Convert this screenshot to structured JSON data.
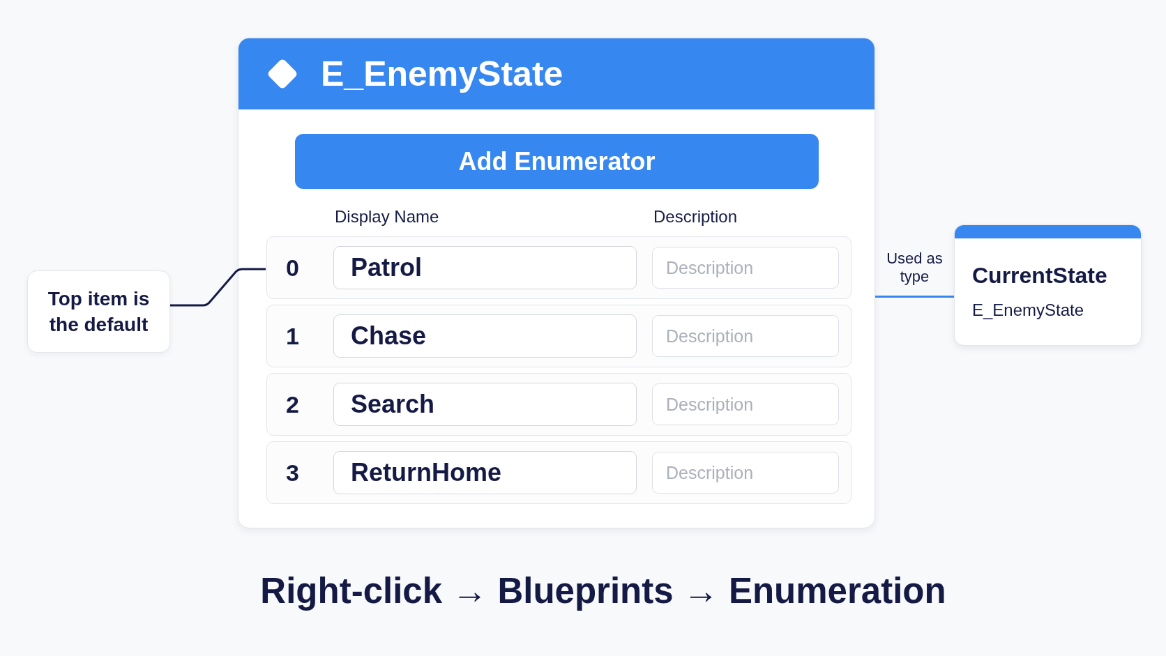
{
  "callout": {
    "text": "Top item is the default"
  },
  "enum_editor": {
    "title": "E_EnemyState",
    "add_button": "Add Enumerator",
    "columns": [
      "Display Name",
      "Description"
    ],
    "enumerators": [
      {
        "index": "0",
        "display_name": "Patrol",
        "description": {
          "placeholder": "Description"
        }
      },
      {
        "index": "1",
        "display_name": "Chase",
        "description": {
          "placeholder": "Description"
        }
      },
      {
        "index": "2",
        "display_name": "Search",
        "description": {
          "placeholder": "Description"
        }
      },
      {
        "index": "3",
        "display_name": "ReturnHome",
        "description": {
          "placeholder": "Description"
        }
      }
    ]
  },
  "type_link": {
    "label": "Used as type"
  },
  "variable_card": {
    "name": "CurrentState",
    "type": "E_EnemyState"
  },
  "caption": "Right-click → Blueprints → Enumeration"
}
